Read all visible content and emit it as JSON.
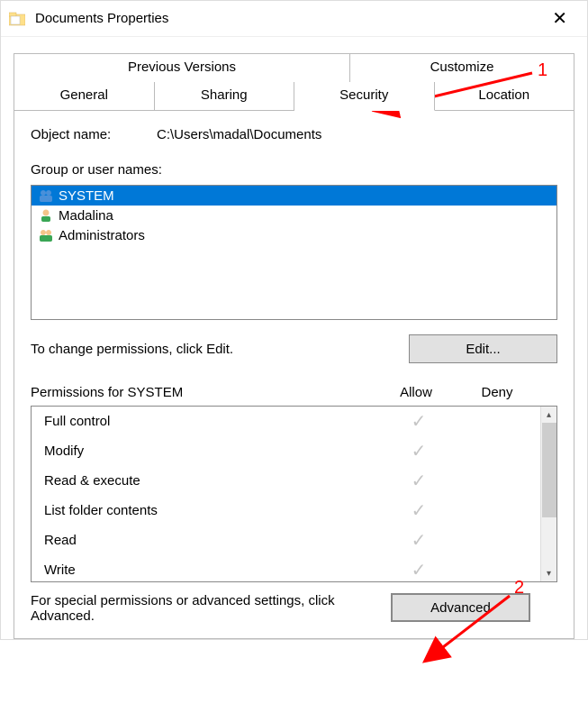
{
  "window": {
    "title": "Documents Properties"
  },
  "tabs": {
    "top": [
      {
        "label": "Previous Versions"
      },
      {
        "label": "Customize"
      }
    ],
    "bottom": [
      {
        "label": "General"
      },
      {
        "label": "Sharing"
      },
      {
        "label": "Security"
      },
      {
        "label": "Location"
      }
    ],
    "active": "Security"
  },
  "security": {
    "object_name_label": "Object name:",
    "object_name_value": "C:\\Users\\madal\\Documents",
    "group_label": "Group or user names:",
    "users": [
      {
        "name": "SYSTEM",
        "icon": "group",
        "selected": true
      },
      {
        "name": "Madalina",
        "icon": "user",
        "selected": false
      },
      {
        "name": "Administrators",
        "icon": "group",
        "selected": false
      }
    ],
    "edit_hint": "To change permissions, click Edit.",
    "edit_button": "Edit...",
    "perm_label": "Permissions for SYSTEM",
    "allow_label": "Allow",
    "deny_label": "Deny",
    "permissions": [
      {
        "name": "Full control",
        "allow": true,
        "deny": false
      },
      {
        "name": "Modify",
        "allow": true,
        "deny": false
      },
      {
        "name": "Read & execute",
        "allow": true,
        "deny": false
      },
      {
        "name": "List folder contents",
        "allow": true,
        "deny": false
      },
      {
        "name": "Read",
        "allow": true,
        "deny": false
      },
      {
        "name": "Write",
        "allow": true,
        "deny": false
      }
    ],
    "advanced_hint": "For special permissions or advanced settings, click Advanced.",
    "advanced_button": "Advanced"
  },
  "annotations": {
    "label1": "1",
    "label2": "2"
  }
}
